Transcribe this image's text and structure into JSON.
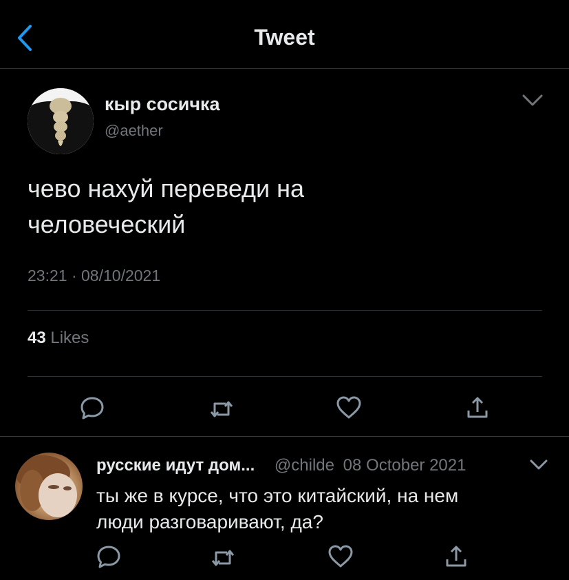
{
  "header": {
    "title": "Tweet",
    "back_icon": "chevron-left-icon"
  },
  "tweet": {
    "author_name": "кыр сосичка",
    "author_handle": "@aether",
    "text_line1": "чево нахуй переведи на",
    "text_line2": "человеческий",
    "time": "23:21",
    "separator": "·",
    "date": "08/10/2021",
    "likes_count": "43",
    "likes_label": "Likes",
    "actions": [
      "reply-icon",
      "retweet-icon",
      "like-icon",
      "share-icon"
    ]
  },
  "reply": {
    "author_name": "русские идут дом...",
    "author_handle": "@childe",
    "date": "08 October 2021",
    "text_line1": "ты же в курсе, что это китайский, на нем",
    "text_line2": "люди разговаривают, да?",
    "actions": [
      "reply-icon",
      "retweet-icon",
      "like-icon",
      "share-icon"
    ]
  },
  "colors": {
    "background": "#000000",
    "text": "#e7e9ea",
    "secondary": "#71767b",
    "accent": "#1d9bf0",
    "divider": "#2f3336"
  }
}
